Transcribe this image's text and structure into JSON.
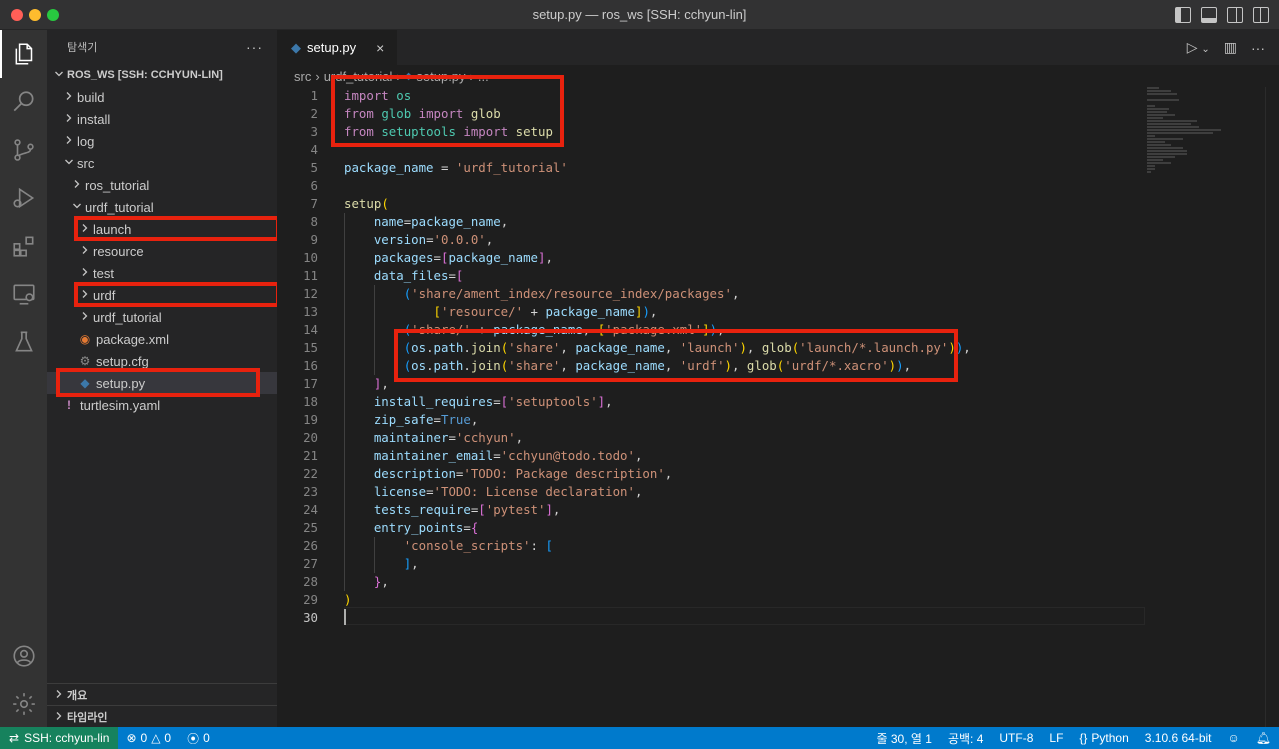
{
  "window": {
    "title": "setup.py — ros_ws [SSH: cchyun-lin]"
  },
  "sidebar": {
    "header": "탐색기",
    "more": "···",
    "workspace": "ROS_WS [SSH: CCHYUN-LIN]",
    "tree": [
      {
        "label": "build",
        "type": "folder",
        "open": false,
        "depth": 1
      },
      {
        "label": "install",
        "type": "folder",
        "open": false,
        "depth": 1
      },
      {
        "label": "log",
        "type": "folder",
        "open": false,
        "depth": 1
      },
      {
        "label": "src",
        "type": "folder",
        "open": true,
        "depth": 1
      },
      {
        "label": "ros_tutorial",
        "type": "folder",
        "open": false,
        "depth": 2
      },
      {
        "label": "urdf_tutorial",
        "type": "folder",
        "open": true,
        "depth": 2
      },
      {
        "label": "launch",
        "type": "folder",
        "open": false,
        "depth": 3
      },
      {
        "label": "resource",
        "type": "folder",
        "open": false,
        "depth": 3
      },
      {
        "label": "test",
        "type": "folder",
        "open": false,
        "depth": 3
      },
      {
        "label": "urdf",
        "type": "folder",
        "open": false,
        "depth": 3
      },
      {
        "label": "urdf_tutorial",
        "type": "folder",
        "open": false,
        "depth": 3
      },
      {
        "label": "package.xml",
        "type": "xml",
        "depth": 3
      },
      {
        "label": "setup.cfg",
        "type": "cfg",
        "depth": 3
      },
      {
        "label": "setup.py",
        "type": "py",
        "depth": 3,
        "selected": true
      },
      {
        "label": "turtlesim.yaml",
        "type": "yaml",
        "depth": 1
      }
    ],
    "sections": [
      "개요",
      "타임라인"
    ]
  },
  "editor": {
    "tab": {
      "label": "setup.py",
      "close": "×"
    },
    "breadcrumb": [
      "src",
      "urdf_tutorial",
      "setup.py",
      "..."
    ],
    "line_numbers": [
      "1",
      "2",
      "3",
      "4",
      "5",
      "6",
      "7",
      "8",
      "9",
      "10",
      "11",
      "12",
      "13",
      "14",
      "15",
      "16",
      "17",
      "18",
      "19",
      "20",
      "21",
      "22",
      "23",
      "24",
      "25",
      "26",
      "27",
      "28",
      "29",
      "30"
    ],
    "current_line": "30"
  },
  "status": {
    "remote": "SSH: cchyun-lin",
    "errors": "0",
    "warnings": "0",
    "ports": "0",
    "position": "줄 30, 열 1",
    "spaces": "공백: 4",
    "encoding": "UTF-8",
    "eol": "LF",
    "language": "Python",
    "interpreter": "3.10.6 64-bit"
  },
  "colors": {
    "accent": "#007acc",
    "remote": "#16825d",
    "highlight_box": "#e8220e"
  }
}
